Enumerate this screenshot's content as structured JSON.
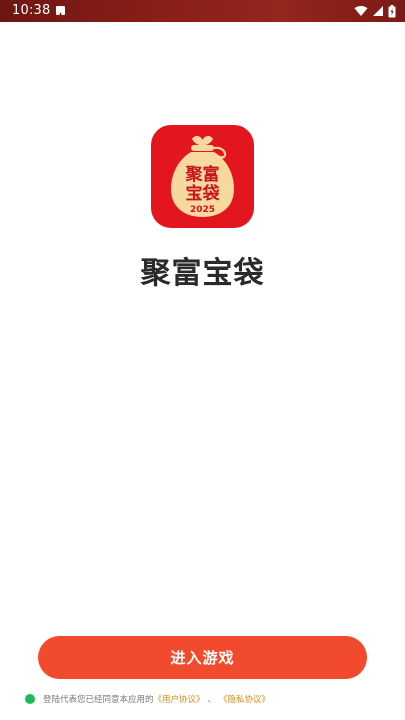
{
  "status_bar": {
    "time": "10:38",
    "icons": [
      "notification-a-icon",
      "wifi-icon",
      "signal-icon",
      "battery-icon"
    ]
  },
  "app": {
    "title": "聚富宝袋",
    "logo": {
      "icon": "money-bag-logo-icon",
      "text_top": "聚富",
      "text_bottom": "宝袋",
      "year": "2025",
      "bg_color": "#e3161f",
      "bag_color": "#f7d9a0"
    }
  },
  "enter_button": {
    "label": "进入游戏",
    "color": "#f24a2c"
  },
  "agreement": {
    "text": "登陆代表您已经同意本应用的",
    "user_agreement": "《用户协议》",
    "separator": "、",
    "privacy_policy": "《隐私协议》",
    "check_color": "#1db954",
    "link_color": "#d88a1a"
  }
}
